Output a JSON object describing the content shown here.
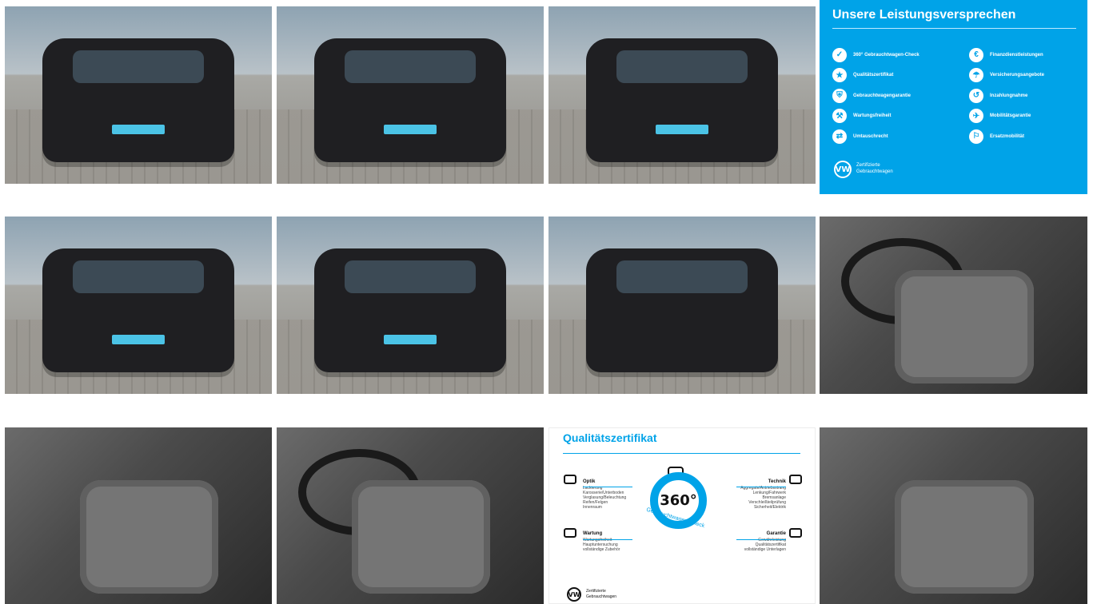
{
  "leistungen": {
    "title": "Unsere Leistungsversprechen",
    "left_items": [
      {
        "label": "360° Gebrauchtwagen-Check",
        "icon": "car-check-icon"
      },
      {
        "label": "Qualitätszertifikat",
        "icon": "certificate-icon"
      },
      {
        "label": "Gebrauchtwagengarantie",
        "icon": "shield-icon"
      },
      {
        "label": "Wartungsfreiheit",
        "icon": "wrench-icon"
      },
      {
        "label": "Umtauschrecht",
        "icon": "swap-icon"
      }
    ],
    "right_items": [
      {
        "label": "Finanzdienstleistungen",
        "icon": "finance-icon"
      },
      {
        "label": "Versicherungsangebote",
        "icon": "umbrella-icon"
      },
      {
        "label": "Inzahlungnahme",
        "icon": "trade-in-icon"
      },
      {
        "label": "Mobilitätsgarantie",
        "icon": "mobility-icon"
      },
      {
        "label": "Ersatzmobilität",
        "icon": "replacement-car-icon"
      }
    ],
    "badge_line1": "Zertifizierte",
    "badge_line2": "Gebrauchtwagen"
  },
  "zertifikat": {
    "title": "Qualitätszertifikat",
    "center_label": "360°",
    "arc_label": "Gebrauchtwagen-Check",
    "groups": {
      "optik": {
        "heading": "Optik",
        "lines": [
          "Lackierung",
          "Karosserie/Unterboden",
          "Verglasung/Beleuchtung",
          "Reifen/Felgen",
          "Innenraum"
        ]
      },
      "technik": {
        "heading": "Technik",
        "lines": [
          "Aggregate/Antriebsstrang",
          "Lenkung/Fahrwerk",
          "Bremsanlage",
          "Verschleißteilprüfung",
          "Sicherheit/Elektrik"
        ]
      },
      "wartung": {
        "heading": "Wartung",
        "lines": [
          "Wartungsfreiheit",
          "Hauptuntersuchung",
          "vollständige Zubehör"
        ]
      },
      "garantie": {
        "heading": "Garantie",
        "lines": [
          "Gewährleistung",
          "Qualitätszertifikat",
          "vollständige Unterlagen"
        ]
      }
    },
    "badge_line1": "Zertifizierte",
    "badge_line2": "Gebrauchtwagen"
  }
}
